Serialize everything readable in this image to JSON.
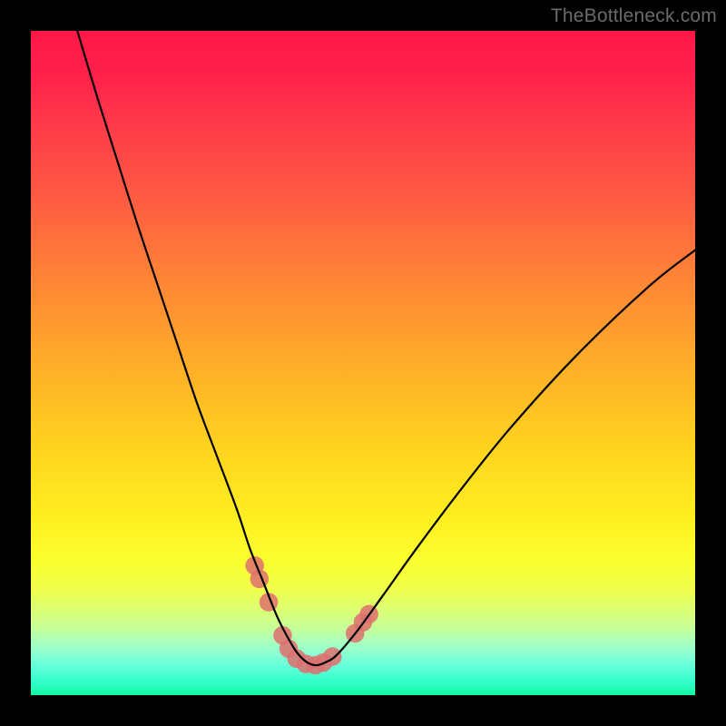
{
  "watermark": "TheBottleneck.com",
  "chart_data": {
    "type": "line",
    "title": "",
    "xlabel": "",
    "ylabel": "",
    "xlim": [
      0,
      100
    ],
    "ylim": [
      0,
      100
    ],
    "grid": false,
    "series": [
      {
        "name": "bottleneck-curve",
        "color": "#000000",
        "x": [
          7,
          10,
          13,
          16,
          19,
          22,
          25,
          28,
          31,
          33,
          35,
          37,
          38.5,
          40,
          41.5,
          43,
          44.5,
          46,
          49,
          53,
          58,
          64,
          72,
          82,
          93,
          100
        ],
        "y": [
          100,
          90,
          80.5,
          71,
          62,
          53,
          44,
          36,
          28,
          22,
          17,
          12,
          9,
          6.5,
          5,
          4.5,
          5,
          6,
          9.5,
          15,
          22,
          30,
          40,
          51,
          61.5,
          67
        ]
      }
    ],
    "markers": {
      "name": "threshold-markers",
      "color": "#de6e6e",
      "points": [
        {
          "x": 33.7,
          "y": 19.5
        },
        {
          "x": 34.4,
          "y": 17.5
        },
        {
          "x": 35.8,
          "y": 14.0
        },
        {
          "x": 37.9,
          "y": 9.0
        },
        {
          "x": 38.8,
          "y": 7.0
        },
        {
          "x": 40.0,
          "y": 5.5
        },
        {
          "x": 41.4,
          "y": 4.7
        },
        {
          "x": 42.8,
          "y": 4.5
        },
        {
          "x": 44.0,
          "y": 4.9
        },
        {
          "x": 45.4,
          "y": 5.8
        },
        {
          "x": 48.8,
          "y": 9.3
        },
        {
          "x": 50.0,
          "y": 11.0
        },
        {
          "x": 50.9,
          "y": 12.2
        }
      ],
      "radius_data_units": 1.4
    },
    "background": {
      "type": "vertical-gradient",
      "stops": [
        {
          "pos": 0.0,
          "color": "#ff1846"
        },
        {
          "pos": 0.5,
          "color": "#ffb327"
        },
        {
          "pos": 0.8,
          "color": "#fbff2f"
        },
        {
          "pos": 1.0,
          "color": "#17f7a8"
        }
      ]
    }
  }
}
